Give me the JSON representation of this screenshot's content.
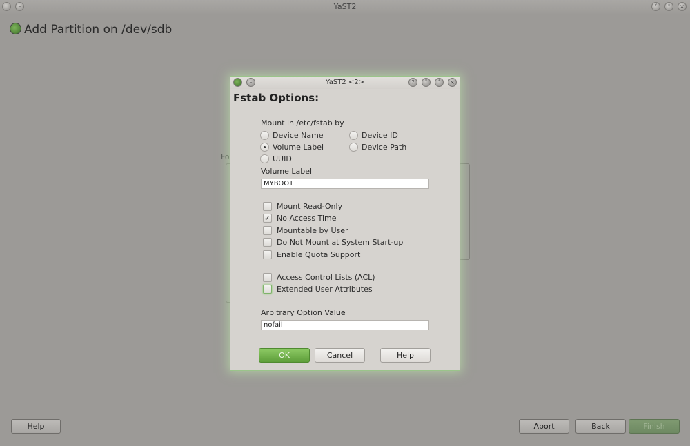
{
  "window": {
    "title": "YaST2"
  },
  "page": {
    "title": "Add Partition on /dev/sdb"
  },
  "background": {
    "partial_label": "Fo"
  },
  "bottom_buttons": {
    "help": "Help",
    "abort": "Abort",
    "back": "Back",
    "finish": "Finish"
  },
  "dialog": {
    "title": "YaST2 <2>",
    "heading": "Fstab Options:",
    "mount_by": {
      "label": "Mount in /etc/fstab by",
      "options": [
        {
          "label": "Device Name",
          "selected": false
        },
        {
          "label": "Device ID",
          "selected": false
        },
        {
          "label": "Volume Label",
          "selected": true
        },
        {
          "label": "Device Path",
          "selected": false
        },
        {
          "label": "UUID",
          "selected": false
        }
      ]
    },
    "volume_label": {
      "label": "Volume Label",
      "value": "MYBOOT"
    },
    "checkboxes": [
      {
        "label": "Mount Read-Only",
        "checked": false
      },
      {
        "label": "No Access Time",
        "checked": true
      },
      {
        "label": "Mountable by User",
        "checked": false
      },
      {
        "label": "Do Not Mount at System Start-up",
        "checked": false
      },
      {
        "label": "Enable Quota Support",
        "checked": false
      },
      {
        "label": "Access Control Lists (ACL)",
        "checked": false
      },
      {
        "label": "Extended User Attributes",
        "checked": false
      }
    ],
    "arbitrary": {
      "label": "Arbitrary Option Value",
      "value": "nofail"
    },
    "buttons": {
      "ok": "OK",
      "cancel": "Cancel",
      "help": "Help"
    }
  }
}
